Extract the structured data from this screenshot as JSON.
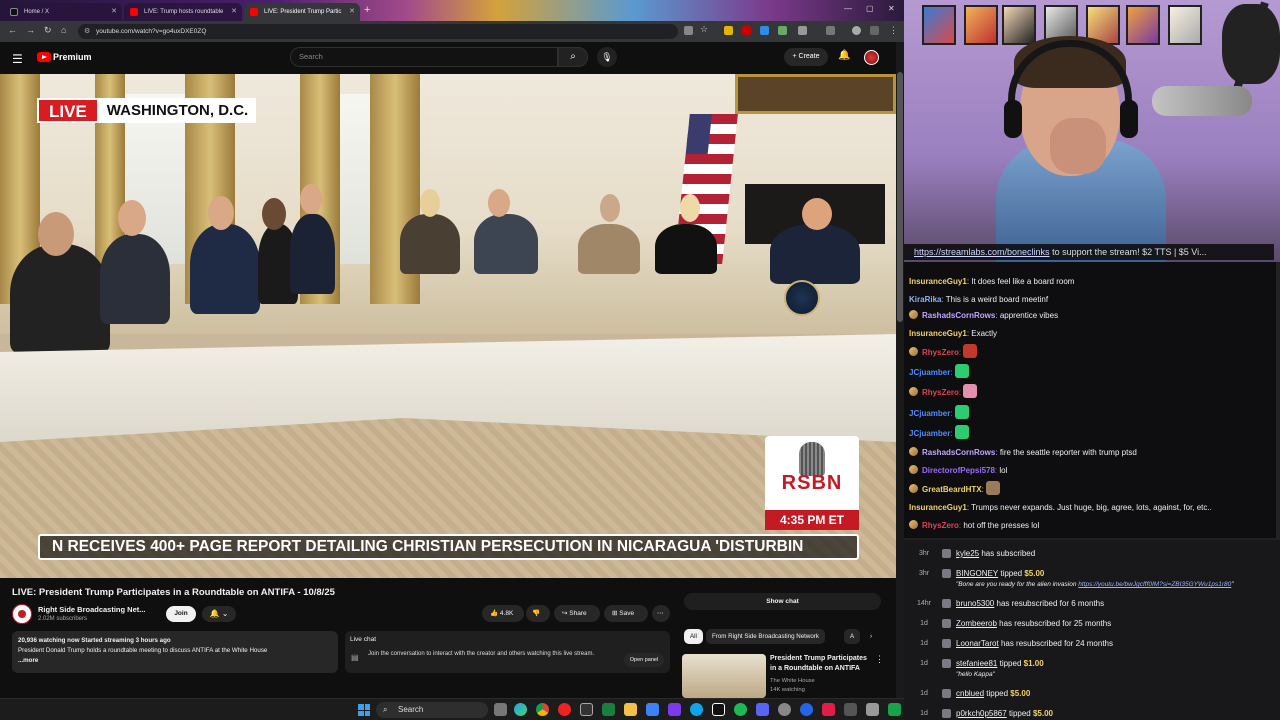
{
  "browser": {
    "tabs": [
      {
        "label": "Home / X",
        "active": false
      },
      {
        "label": "LIVE: Trump hosts roundtable",
        "active": false
      },
      {
        "label": "LIVE: President Trump Partic",
        "active": true
      }
    ],
    "new_tab": "+",
    "url": "youtube.com/watch?v=go4uxDXE0ZQ"
  },
  "youtube": {
    "logo_text": "Premium",
    "search_placeholder": "Search",
    "create_label": "Create",
    "video": {
      "live_tag": "LIVE",
      "location": "WASHINGTON, D.C.",
      "ticker": "N RECEIVES 400+ PAGE REPORT DETAILING CHRISTIAN PERSECUTION IN NICARAGUA    'DISTURBIN",
      "rsbn_name": "RSBN",
      "rsbn_time": "4:35 PM ET"
    },
    "title": "LIVE: President Trump Participates in a Roundtable on ANTIFA - 10/8/25",
    "channel": {
      "name": "Right Side Broadcasting Net...",
      "subscribers": "2.02M subscribers",
      "join": "Join"
    },
    "actions": {
      "likes": "4.8K",
      "share": "Share",
      "save": "Save"
    },
    "description": {
      "stats": "20,936 watching now  Started streaming 3 hours ago",
      "text": "President Donald Trump holds a roundtable meeting to discuss ANTIFA at the White House",
      "more": "...more"
    },
    "live_chat": {
      "title": "Live chat",
      "text": "Join the conversation to interact with the creator and others watching this live stream.",
      "open": "Open panel"
    },
    "show_chat": "Show chat",
    "chips": {
      "all": "All",
      "from": "From Right Side Broadcasting Network",
      "more": "A"
    },
    "related": {
      "title": "President Trump Participates in a Roundtable on ANTIFA",
      "channel": "The White House",
      "watching": "14K watching"
    }
  },
  "stream": {
    "banner_link": "https://streamlabs.com/boneclinks",
    "banner_text": " to support the stream! $2 TTS | $5 Vi..."
  },
  "chat": [
    {
      "user": "InsuranceGuy1",
      "color": "#f0d36a",
      "text": "It does feel like a board room",
      "badge": false
    },
    {
      "user": "KiraRika",
      "color": "#8ab4f8",
      "text": "This is a weird board meetinf",
      "badge": false
    },
    {
      "user": "RashadsCornRows",
      "color": "#c2a6ff",
      "text": "apprentice vibes",
      "badge": true
    },
    {
      "user": "InsuranceGuy1",
      "color": "#f0d36a",
      "text": "Exactly",
      "badge": false
    },
    {
      "user": "RhysZero",
      "color": "#e0434f",
      "text": "",
      "badge": true
    },
    {
      "user": "JCjuamber",
      "color": "#4f8cff",
      "text": "",
      "badge": false
    },
    {
      "user": "RhysZero",
      "color": "#e0434f",
      "text": "",
      "badge": true
    },
    {
      "user": "JCjuamber",
      "color": "#4f8cff",
      "text": "",
      "badge": false
    },
    {
      "user": "JCjuamber",
      "color": "#4f8cff",
      "text": "",
      "badge": false
    },
    {
      "user": "RashadsCornRows",
      "color": "#c2a6ff",
      "text": "fire the seattle reporter with trump ptsd",
      "badge": true
    },
    {
      "user": "DirectorofPepsi578",
      "color": "#9a6cff",
      "text": "lol",
      "badge": true
    },
    {
      "user": "GreatBeardHTX",
      "color": "#f0d36a",
      "text": "",
      "badge": true
    },
    {
      "user": "InsuranceGuy1",
      "color": "#f0d36a",
      "text": "Trumps never expands. Just huge, big, agree, lots, against, for, etc..",
      "badge": false
    },
    {
      "user": "RhysZero",
      "color": "#e0434f",
      "text": "hot off the presses lol",
      "badge": true
    }
  ],
  "alerts": [
    {
      "time": "3hr",
      "name": "kyle25",
      "text": "has subscribed",
      "amount": ""
    },
    {
      "time": "3hr",
      "name": "BINGONEY",
      "text": "tipped",
      "amount": "$5.00",
      "sub": "\"Bone are you ready for the alien invasion ",
      "sub_link": "https://youtu.be/bwJgcfff0IM?si=ZBI35GYWu1ps1r80"
    },
    {
      "time": "14hr",
      "name": "bruno5300",
      "text": "has resubscribed for 6 months",
      "amount": ""
    },
    {
      "time": "1d",
      "name": "Zombeerob",
      "text": "has resubscribed for 25 months",
      "amount": ""
    },
    {
      "time": "1d",
      "name": "LoonarTarot",
      "text": "has resubscribed for 24 months",
      "amount": ""
    },
    {
      "time": "1d",
      "name": "stefaniee81",
      "text": "tipped",
      "amount": "$1.00",
      "sub": "\"hello Kappa\"",
      "sub_link": ""
    },
    {
      "time": "1d",
      "name": "cnblued",
      "text": "tipped",
      "amount": "$5.00"
    },
    {
      "time": "1d",
      "name": "p0rkch0p5867",
      "text": "tipped",
      "amount": "$5.00"
    }
  ],
  "taskbar": {
    "search": "Search"
  }
}
